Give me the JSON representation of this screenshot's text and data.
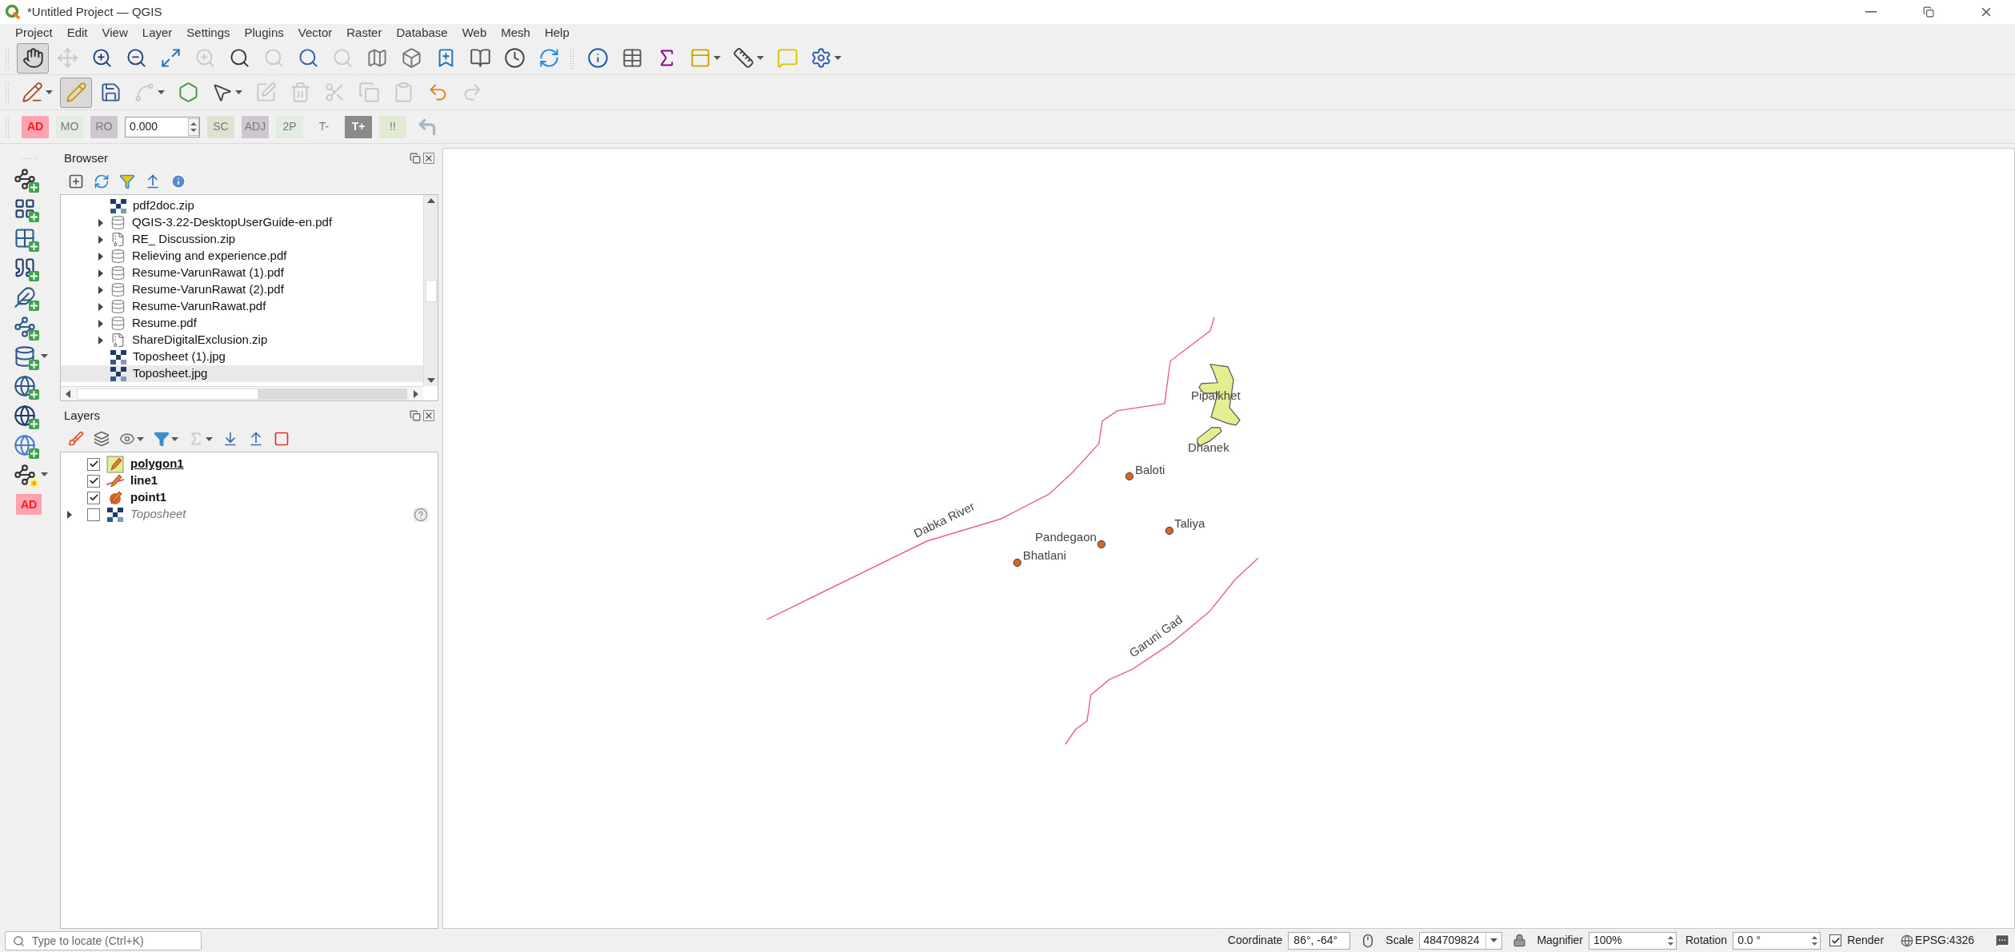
{
  "window": {
    "title": "*Untitled Project — QGIS"
  },
  "menu": [
    "Project",
    "Edit",
    "View",
    "Layer",
    "Settings",
    "Plugins",
    "Vector",
    "Raster",
    "Database",
    "Web",
    "Mesh",
    "Help"
  ],
  "map_navigation_toolbar": [
    {
      "kind": "pan",
      "disabled": false,
      "active": true,
      "menu": false
    },
    {
      "kind": "pan_selection",
      "disabled": true,
      "active": false,
      "menu": false
    },
    {
      "kind": "zoom_in",
      "disabled": false,
      "active": false,
      "menu": false
    },
    {
      "kind": "zoom_out",
      "disabled": false,
      "active": false,
      "menu": false
    },
    {
      "kind": "zoom_full",
      "disabled": false,
      "active": false,
      "menu": false
    },
    {
      "kind": "zoom_selection",
      "disabled": true,
      "active": false,
      "menu": false
    },
    {
      "kind": "zoom_layer",
      "disabled": false,
      "active": false,
      "menu": false
    },
    {
      "kind": "zoom_native",
      "disabled": true,
      "active": false,
      "menu": false
    },
    {
      "kind": "zoom_last",
      "disabled": false,
      "active": false,
      "menu": false
    },
    {
      "kind": "zoom_next",
      "disabled": true,
      "active": false,
      "menu": false
    },
    {
      "kind": "new_map_view",
      "disabled": false,
      "active": false,
      "menu": false
    },
    {
      "kind": "new_3d_view",
      "disabled": false,
      "active": false,
      "menu": false
    },
    {
      "kind": "new_bookmark",
      "disabled": false,
      "active": false,
      "menu": false
    },
    {
      "kind": "show_bookmarks",
      "disabled": false,
      "active": false,
      "menu": false
    },
    {
      "kind": "temporal",
      "disabled": false,
      "active": false,
      "menu": false
    },
    {
      "kind": "refresh",
      "disabled": false,
      "active": false,
      "menu": false
    }
  ],
  "attributes_toolbar": [
    {
      "kind": "identify",
      "disabled": false,
      "active": false,
      "menu": false
    },
    {
      "kind": "attribute_table",
      "disabled": false,
      "active": false,
      "menu": false
    },
    {
      "kind": "statistics",
      "disabled": false,
      "active": false,
      "menu": false
    },
    {
      "kind": "field_calc",
      "disabled": false,
      "active": false,
      "menu": true
    },
    {
      "kind": "measure",
      "disabled": false,
      "active": false,
      "menu": true
    },
    {
      "kind": "map_tips",
      "disabled": false,
      "active": false,
      "menu": false
    },
    {
      "kind": "actions",
      "disabled": false,
      "active": false,
      "menu": true
    }
  ],
  "digitizing_toolbar": [
    {
      "kind": "current_edits",
      "disabled": false,
      "active": false,
      "menu": true
    },
    {
      "kind": "toggle_edit",
      "disabled": false,
      "active": true,
      "menu": false
    },
    {
      "kind": "save_edits",
      "disabled": false,
      "active": false,
      "menu": false
    },
    {
      "kind": "add_line",
      "disabled": true,
      "active": false,
      "menu": true
    },
    {
      "kind": "add_polygon",
      "disabled": false,
      "active": false,
      "menu": false
    },
    {
      "kind": "vertex_tool",
      "disabled": false,
      "active": false,
      "menu": true
    },
    {
      "kind": "modify_attributes",
      "disabled": true,
      "active": false,
      "menu": false
    },
    {
      "kind": "delete_selected",
      "disabled": true,
      "active": false,
      "menu": false
    },
    {
      "kind": "cut",
      "disabled": true,
      "active": false,
      "menu": false
    },
    {
      "kind": "copy",
      "disabled": true,
      "active": false,
      "menu": false
    },
    {
      "kind": "paste",
      "disabled": true,
      "active": false,
      "menu": false
    },
    {
      "kind": "undo",
      "disabled": false,
      "active": false,
      "menu": false
    },
    {
      "kind": "redo",
      "disabled": true,
      "active": false,
      "menu": false
    }
  ],
  "cad_toolbar": [
    {
      "kind": "button",
      "label": "AD",
      "disabled": false,
      "color": "#ffa3b1"
    },
    {
      "kind": "button",
      "label": "MO",
      "disabled": true,
      "color": "#e3ece3"
    },
    {
      "kind": "button",
      "label": "RO",
      "disabled": true,
      "color": "#cfc6d2"
    },
    {
      "kind": "field",
      "value": "0.000",
      "disabled": false
    },
    {
      "kind": "button",
      "label": "SC",
      "disabled": true,
      "color": "#dde3d0"
    },
    {
      "kind": "button",
      "label": "ADJ",
      "disabled": true,
      "color": "#cfc6d2"
    },
    {
      "kind": "button",
      "label": "2P",
      "disabled": true,
      "color": "#e1ede3"
    },
    {
      "kind": "button",
      "label": "T-",
      "disabled": true,
      "color": "#f0f0f0"
    },
    {
      "kind": "button",
      "label": "T+",
      "disabled": false,
      "color": "#8a8a8a"
    },
    {
      "kind": "button",
      "label": "!!",
      "disabled": true,
      "color": "#e3ead2"
    },
    {
      "kind": "icon",
      "disabled": true
    }
  ],
  "data_source_toolbar": [
    {
      "kind": "add_vector",
      "menu": false
    },
    {
      "kind": "add_raster",
      "menu": false
    },
    {
      "kind": "add_mesh",
      "menu": false
    },
    {
      "kind": "add_delimited",
      "menu": false
    },
    {
      "kind": "add_gpx",
      "menu": false
    },
    {
      "kind": "add_spatialite",
      "menu": false
    },
    {
      "kind": "add_postgis",
      "menu": true
    },
    {
      "kind": "add_wms",
      "menu": false
    },
    {
      "kind": "add_wcs",
      "menu": false
    },
    {
      "kind": "add_wfs",
      "menu": false
    },
    {
      "kind": "new_layer",
      "menu": true
    },
    {
      "kind": "text",
      "label": "AD"
    }
  ],
  "browser": {
    "title": "Browser",
    "items": [
      {
        "label": "pdf2doc.zip",
        "kind": "raster",
        "expandable": false,
        "selected": false
      },
      {
        "label": "QGIS-3.22-DesktopUserGuide-en.pdf",
        "kind": "database",
        "expandable": true,
        "selected": false
      },
      {
        "label": "RE_ Discussion.zip",
        "kind": "zip",
        "expandable": true,
        "selected": false
      },
      {
        "label": "Relieving and experience.pdf",
        "kind": "database",
        "expandable": true,
        "selected": false
      },
      {
        "label": "Resume-VarunRawat (1).pdf",
        "kind": "database",
        "expandable": true,
        "selected": false
      },
      {
        "label": "Resume-VarunRawat (2).pdf",
        "kind": "database",
        "expandable": true,
        "selected": false
      },
      {
        "label": "Resume-VarunRawat.pdf",
        "kind": "database",
        "expandable": true,
        "selected": false
      },
      {
        "label": "Resume.pdf",
        "kind": "database",
        "expandable": true,
        "selected": false
      },
      {
        "label": "ShareDigitalExclusion.zip",
        "kind": "zip",
        "expandable": true,
        "selected": false
      },
      {
        "label": "Toposheet (1).jpg",
        "kind": "raster",
        "expandable": false,
        "selected": false
      },
      {
        "label": "Toposheet.jpg",
        "kind": "raster",
        "expandable": false,
        "selected": true
      }
    ]
  },
  "layers": {
    "title": "Layers",
    "items": [
      {
        "label": "polygon1",
        "kind": "polygon",
        "checked": true,
        "selected": true,
        "editing": true,
        "expandable": false,
        "indicator": false
      },
      {
        "label": "line1",
        "kind": "line",
        "checked": true,
        "selected": false,
        "editing": true,
        "expandable": false,
        "indicator": false
      },
      {
        "label": "point1",
        "kind": "point",
        "checked": true,
        "selected": false,
        "editing": true,
        "expandable": false,
        "indicator": false
      },
      {
        "label": "Toposheet",
        "kind": "raster",
        "checked": false,
        "selected": false,
        "editing": false,
        "expandable": true,
        "indicator": true
      }
    ]
  },
  "map": {
    "rivers": [
      "Dabka River",
      "Garuni Gad"
    ],
    "areas": [
      "Pipalkhet",
      "Dhanek"
    ],
    "villages": [
      "Baloti",
      "Taliya",
      "Pandegaon",
      "Bhatlani"
    ]
  },
  "status_bar": {
    "locate_placeholder": "Type to locate (Ctrl+K)",
    "coordinate_label": "Coordinate",
    "coordinate": "86°, -64°",
    "scale_label": "Scale",
    "scale": "484709824",
    "magnifier_label": "Magnifier",
    "magnifier": "100%",
    "rotation_label": "Rotation",
    "rotation": "0.0 °",
    "render_label": "Render",
    "render": true,
    "crs": "EPSG:4326"
  }
}
